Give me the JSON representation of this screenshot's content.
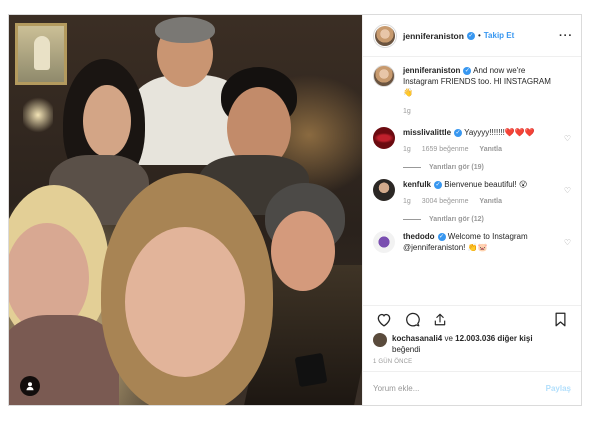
{
  "header": {
    "username": "jenniferaniston",
    "follow_label": "Takip Et",
    "more_label": "···"
  },
  "caption": {
    "username": "jenniferaniston",
    "text": "And now we're Instagram FRIENDS too. HI INSTAGRAM 👋",
    "age": "1g"
  },
  "comments": [
    {
      "username": "misslivalittle",
      "verified": true,
      "text": "Yayyyy!!!!!!!❤️❤️❤️",
      "age": "1g",
      "likes": "1659 beğenme",
      "reply_label": "Yanıtla",
      "view_replies": "Yanıtları gör (19)"
    },
    {
      "username": "kenfulk",
      "verified": true,
      "text": "Bienvenue beautiful! 😮",
      "age": "1g",
      "likes": "3004 beğenme",
      "reply_label": "Yanıtla",
      "view_replies": "Yanıtları gör (12)"
    },
    {
      "username": "thedodo",
      "verified": true,
      "text": "Welcome to Instagram @jenniferaniston! 👏🐷",
      "age": "",
      "likes": "",
      "reply_label": "",
      "view_replies": ""
    }
  ],
  "likes": {
    "user": "kochasanali4",
    "connector": "ve",
    "count": "12.003.036 diğer kişi",
    "suffix": "beğendi"
  },
  "timestamp": "1 GÜN ÖNCE",
  "add_comment": {
    "placeholder": "Yorum ekle...",
    "post_label": "Paylaş"
  },
  "colors": {
    "accent": "#3897f0",
    "text": "#262626",
    "muted": "#999999",
    "border": "#dbdbdb",
    "post_disabled": "#b2dffc"
  },
  "icons": [
    "heart-icon",
    "comment-icon",
    "share-icon",
    "bookmark-icon",
    "user-tag-icon",
    "verified-badge-icon"
  ]
}
